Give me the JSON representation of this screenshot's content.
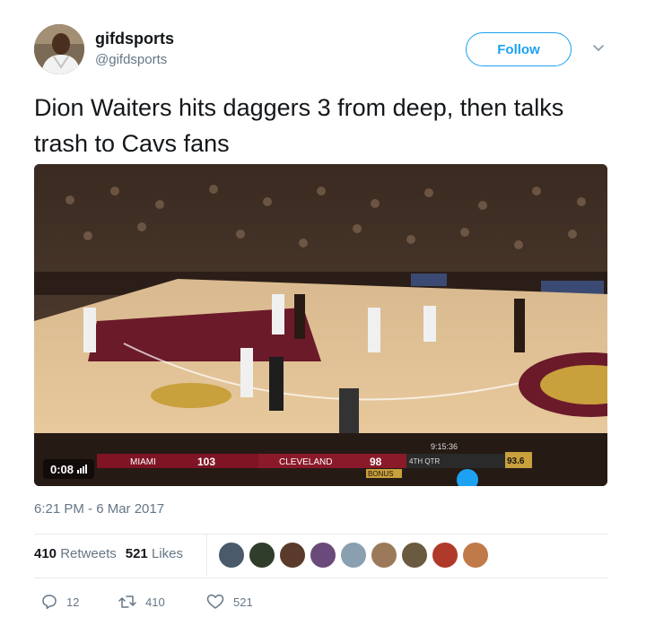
{
  "author": {
    "name": "gifdsports",
    "handle": "@gifdsports"
  },
  "follow_label": "Follow",
  "tweet_text": "Dion Waiters hits daggers 3 from deep, then talks trash to Cavs fans",
  "media": {
    "duration": "0:08",
    "scoreboard": {
      "away_team": "MIAMI",
      "away_score": "103",
      "home_team": "CLEVELAND",
      "home_score": "98",
      "quarter": "4TH QTR",
      "game_clock": "9:15:36",
      "shot_clock": "93.6",
      "bonus": "BONUS"
    }
  },
  "timestamp": "6:21 PM - 6 Mar 2017",
  "stats": {
    "retweets_count": "410",
    "retweets_label": "Retweets",
    "likes_count": "521",
    "likes_label": "Likes"
  },
  "actions": {
    "reply_count": "12",
    "retweet_count": "410",
    "like_count": "521"
  },
  "colors": {
    "accent": "#1da1f2",
    "text": "#14171a",
    "muted": "#657786"
  },
  "icons": [
    "avatar",
    "chevron-down-icon",
    "reply-icon",
    "retweet-icon",
    "heart-icon",
    "signal-bars-icon"
  ]
}
